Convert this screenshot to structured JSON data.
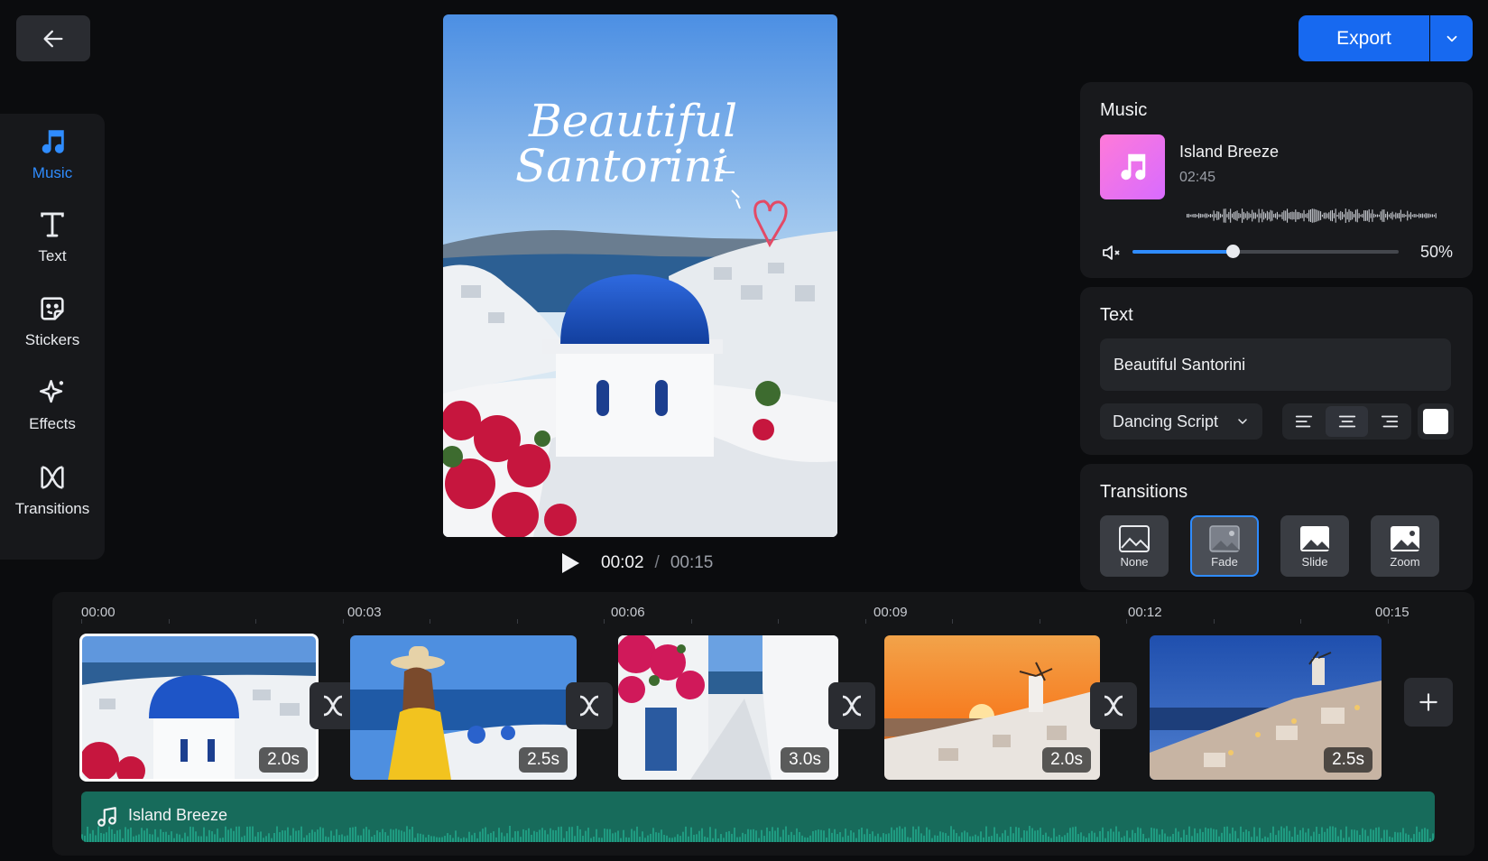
{
  "header": {
    "export_label": "Export"
  },
  "tools": [
    {
      "label": "Music",
      "icon": "music-note-icon",
      "active": true
    },
    {
      "label": "Text",
      "icon": "text-icon"
    },
    {
      "label": "Stickers",
      "icon": "sticker-icon"
    },
    {
      "label": "Effects",
      "icon": "sparkle-icon"
    },
    {
      "label": "Transitions",
      "icon": "transitions-icon"
    }
  ],
  "preview": {
    "overlay_line1": "Beautiful",
    "overlay_line2": "Santorini",
    "current_time": "00:02",
    "separator": "/",
    "total_time": "00:15"
  },
  "music": {
    "title": "Music",
    "track_name": "Island Breeze",
    "track_duration": "02:45",
    "volume_percent": 50,
    "volume_label": "50%"
  },
  "text": {
    "title": "Text",
    "value": "Beautiful Santorini",
    "font": "Dancing Script",
    "alignment": "center",
    "color": "#ffffff"
  },
  "transitions": {
    "title": "Transitions",
    "options": [
      "None",
      "Fade",
      "Slide",
      "Zoom"
    ],
    "selected": "Fade"
  },
  "timeline": {
    "ruler": [
      "00:00",
      "00:03",
      "00:06",
      "00:09",
      "00:12",
      "00:15"
    ],
    "clips": [
      {
        "duration": "2.0s",
        "scene": "blue-dome",
        "selected": true
      },
      {
        "duration": "2.5s",
        "scene": "woman-yellow-dress"
      },
      {
        "duration": "3.0s",
        "scene": "flower-alley"
      },
      {
        "duration": "2.0s",
        "scene": "windmill-sunset"
      },
      {
        "duration": "2.5s",
        "scene": "village-dusk"
      }
    ],
    "audio_track": "Island Breeze"
  },
  "colors": {
    "accent": "#1769f0",
    "audio_track": "#176b5b",
    "background": "#0b0c0e"
  }
}
